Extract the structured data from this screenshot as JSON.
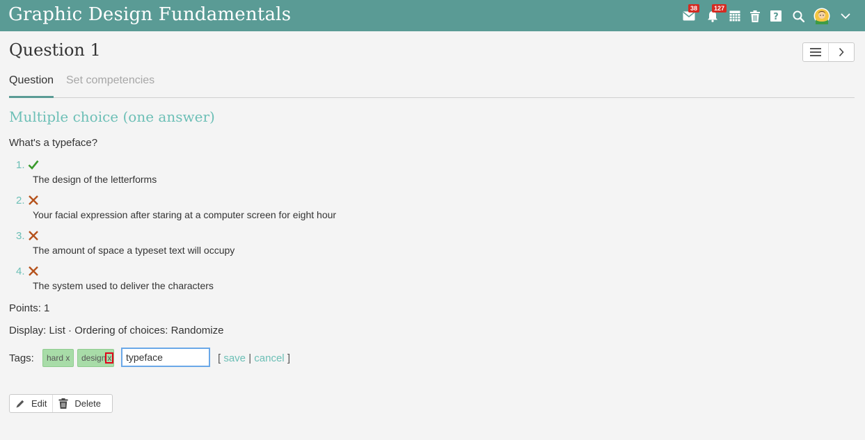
{
  "app": {
    "title": "Graphic Design Fundamentals",
    "brand_color": "#5a9b95",
    "accent_color": "#6cbfb6"
  },
  "toolbar": {
    "messages": {
      "icon": "envelope-icon",
      "count": "38"
    },
    "notifications": {
      "icon": "bell-icon",
      "count": "127"
    },
    "calendar_icon": "calendar-icon",
    "trash_icon": "trash-icon",
    "help_icon": "help-icon",
    "search_icon": "search-icon",
    "avatar_icon": "user-avatar",
    "menu_icon": "chevron-down-icon"
  },
  "header": {
    "title": "Question 1",
    "menu_icon": "list-menu-icon",
    "next_icon": "chevron-right-icon"
  },
  "tabs": [
    {
      "label": "Question",
      "active": true
    },
    {
      "label": "Set competencies",
      "active": false
    }
  ],
  "question": {
    "type": "Multiple choice (one answer)",
    "text": "What's a typeface?",
    "choices": [
      {
        "number": "1.",
        "correct": true,
        "text": "The design of the letterforms"
      },
      {
        "number": "2.",
        "correct": false,
        "text": "Your facial expression after staring at a computer screen for eight hour"
      },
      {
        "number": "3.",
        "correct": false,
        "text": "The amount of space a typeset text will occupy"
      },
      {
        "number": "4.",
        "correct": false,
        "text": "The system used to deliver the characters"
      }
    ],
    "points": "Points: 1",
    "display": "Display: List · Ordering of choices: Randomize"
  },
  "tags": {
    "label": "Tags:",
    "items": [
      {
        "label": "hard",
        "remove": "x"
      },
      {
        "label": "design",
        "remove": "x"
      }
    ],
    "input_value": "typeface",
    "open_bracket": "[",
    "save": "save",
    "separator": "|",
    "cancel": "cancel",
    "close_bracket": "]"
  },
  "actions": {
    "edit": "Edit",
    "delete": "Delete"
  }
}
